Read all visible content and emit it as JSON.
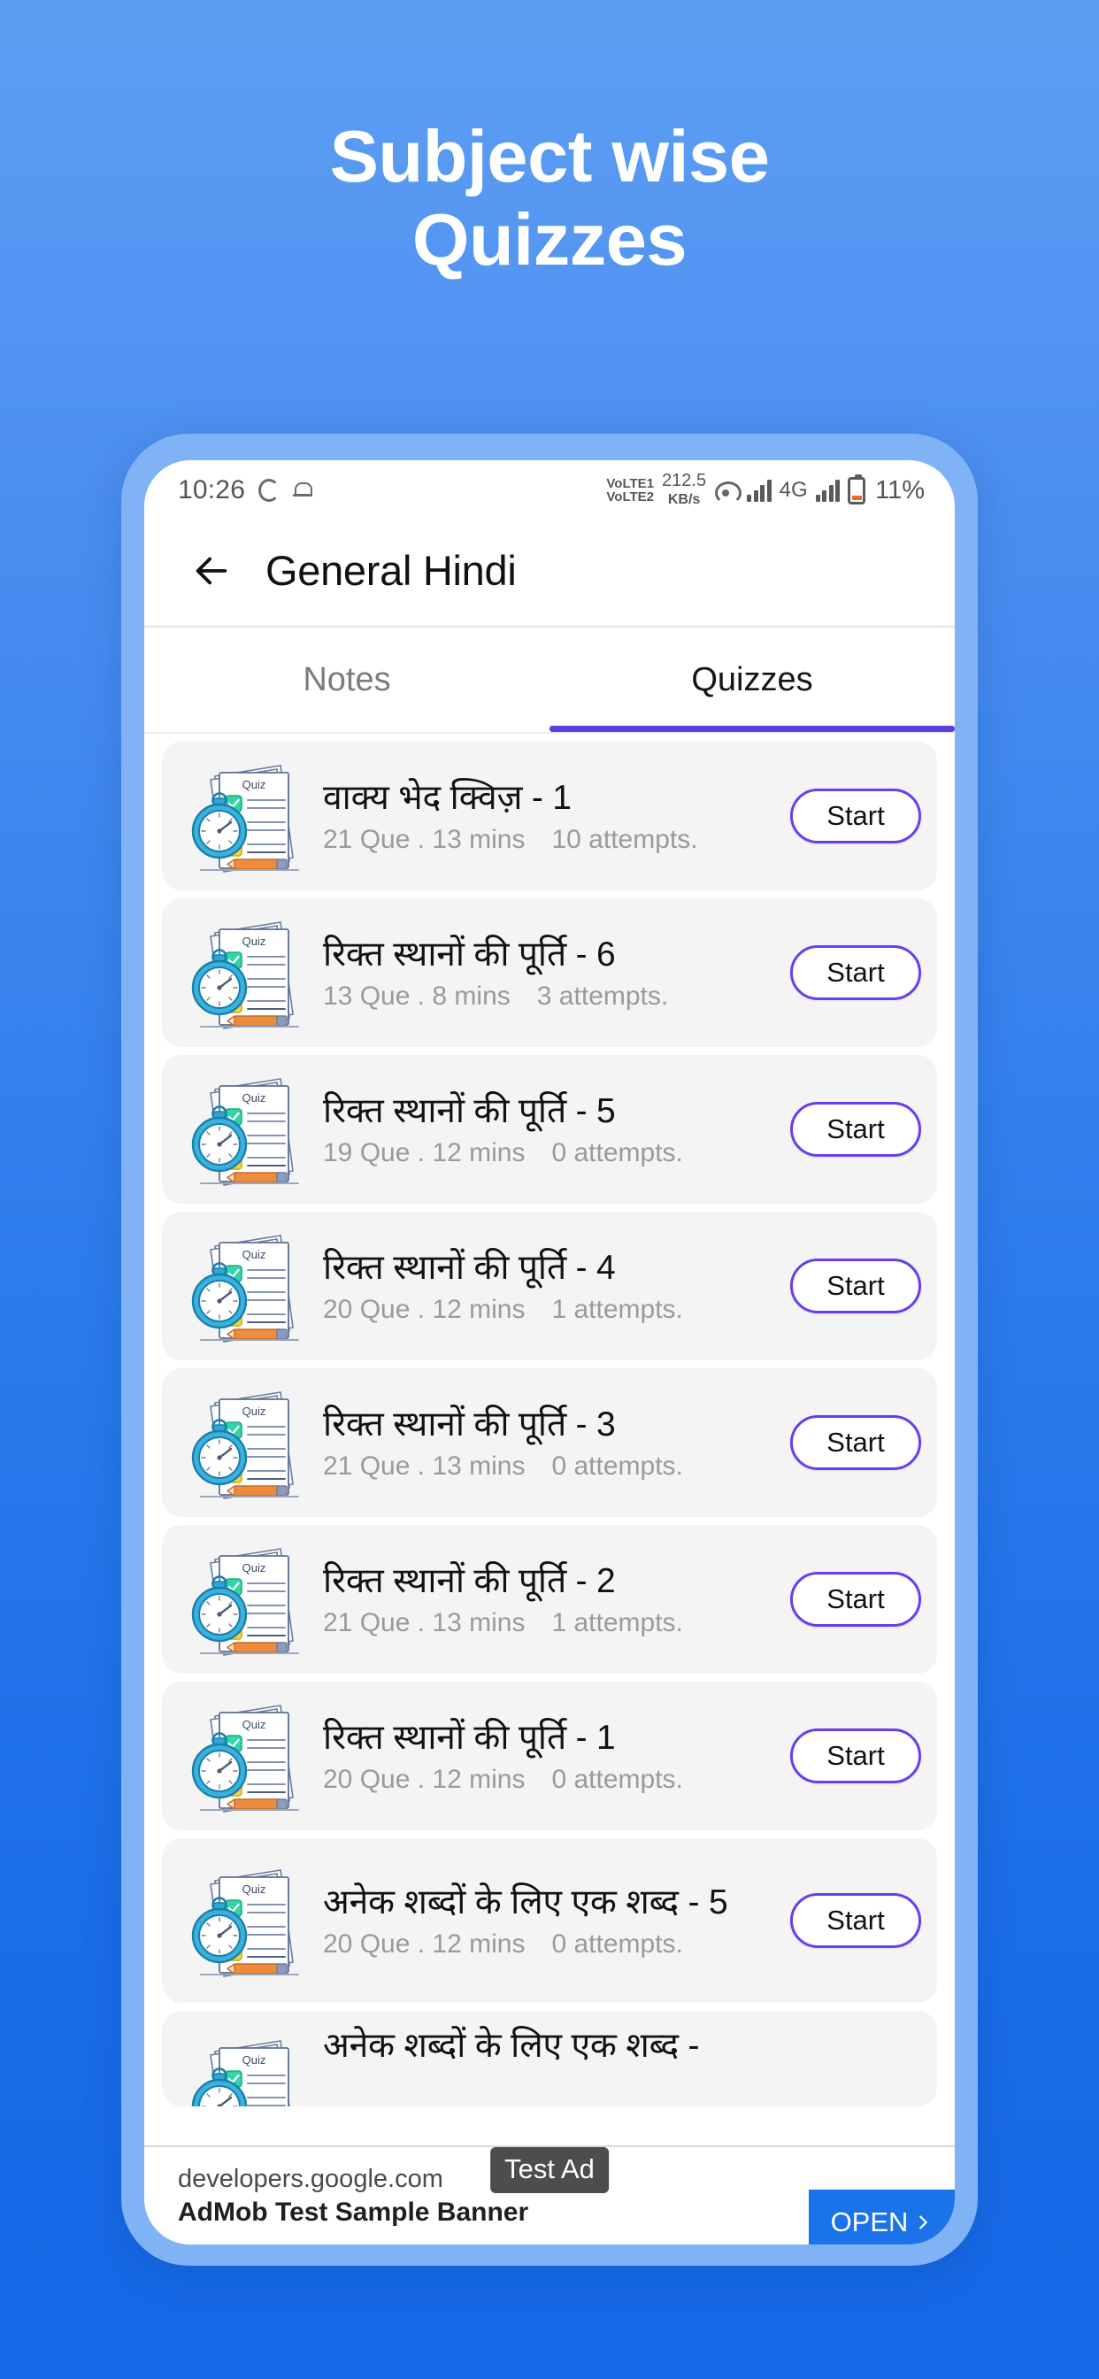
{
  "promo": {
    "line1": "Subject wise",
    "line2": "Quizzes"
  },
  "statusbar": {
    "time": "10:26",
    "volte": "VoLTE",
    "volte_sim1": "1",
    "volte_sim2": "2",
    "datarate_value": "212.5",
    "datarate_unit": "KB/s",
    "network": "4G",
    "battery_percent": "11%"
  },
  "appbar": {
    "title": "General Hindi",
    "back_icon": "arrow-left-icon"
  },
  "tabs": {
    "items": [
      {
        "label": "Notes",
        "active": false
      },
      {
        "label": "Quizzes",
        "active": true
      }
    ]
  },
  "quiz_list": {
    "start_label": "Start",
    "items": [
      {
        "title": "वाक्य भेद क्विज़ - 1",
        "meta": "21 Que . 13 mins",
        "attempts": "10 attempts."
      },
      {
        "title": "रिक्त स्थानों की पूर्ति  - 6",
        "meta": "13 Que . 8 mins",
        "attempts": "3 attempts."
      },
      {
        "title": "रिक्त स्थानों की पूर्ति  - 5",
        "meta": "19 Que . 12 mins",
        "attempts": "0 attempts."
      },
      {
        "title": "रिक्त स्थानों की पूर्ति  - 4",
        "meta": "20 Que . 12 mins",
        "attempts": "1 attempts."
      },
      {
        "title": "रिक्त स्थानों की पूर्ति  - 3",
        "meta": "21 Que . 13 mins",
        "attempts": "0 attempts."
      },
      {
        "title": "रिक्त स्थानों की पूर्ति  - 2",
        "meta": "21 Que . 13 mins",
        "attempts": "1 attempts."
      },
      {
        "title": "रिक्त स्थानों की पूर्ति  - 1",
        "meta": "20 Que . 12 mins",
        "attempts": "0 attempts."
      },
      {
        "title": "अनेक शब्दों के लिए एक शब्द - 5",
        "meta": "20 Que . 12 mins",
        "attempts": "0 attempts."
      },
      {
        "title": "अनेक शब्दों के लिए एक शब्द -",
        "meta": "",
        "attempts": ""
      }
    ],
    "thumb_icon": "quiz-paper-stopwatch-icon",
    "thumb_label": "Quiz"
  },
  "ad": {
    "url": "developers.google.com",
    "headline": "AdMob Test Sample Banner",
    "badge": "Test Ad",
    "open_label": "OPEN",
    "open_chevron": "chevron-right-icon"
  },
  "colors": {
    "bg_top": "#5e9ef2",
    "bg_bottom": "#1568e6",
    "phone_bezel": "#7fb3f6",
    "accent_purple": "#5b3fe0",
    "start_border": "#6a3df0",
    "ad_blue": "#1a73e8",
    "card_bg": "#f4f4f5"
  }
}
